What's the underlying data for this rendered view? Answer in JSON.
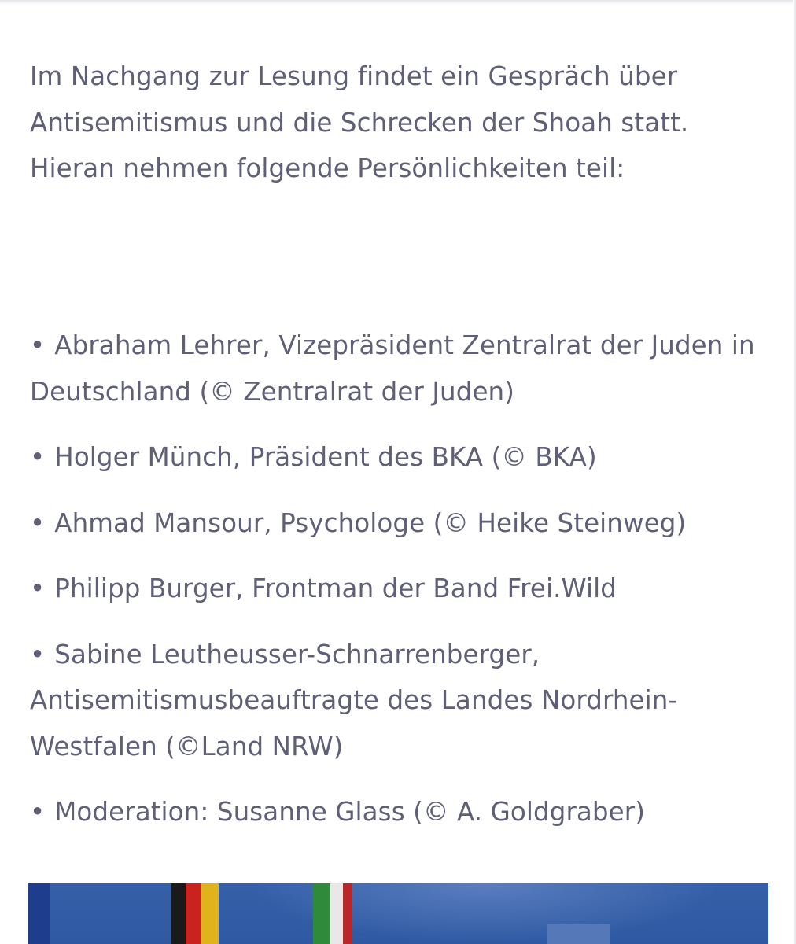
{
  "article": {
    "intro": "Im Nachgang zur Lesung findet ein Gespräch über Antisemitismus und die Schrecken der Shoah statt. Hieran nehmen folgende Persönlichkeiten teil:",
    "bullet": "•",
    "participants": [
      "Abraham Lehrer, Vizepräsident Zentralrat der Juden in Deutschland (© Zentralrat der Juden)",
      "Holger Münch, Präsident des BKA (© BKA)",
      "Ahmad Mansour, Psychologe (© Heike Steinweg)",
      "Philipp Burger, Frontman der Band Frei.Wild",
      "Sabine Leutheusser-Schnarrenberger, Antisemitismusbeauftragte des Landes Nordrhein-Westfalen (©Land NRW)",
      "Moderation: Susanne Glass (© A. Goldgraber)"
    ]
  },
  "colors": {
    "text": "#5f5f78",
    "background": "#ffffff",
    "photo_blue": "#3560a8"
  }
}
